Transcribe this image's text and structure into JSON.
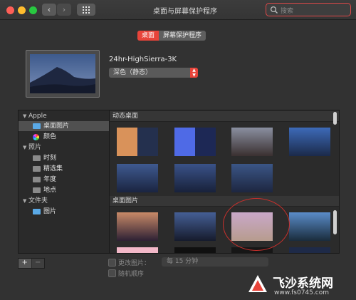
{
  "window": {
    "title": "桌面与屏幕保护程序"
  },
  "search": {
    "placeholder": "搜索"
  },
  "tabs": [
    {
      "label": "桌面",
      "active": true
    },
    {
      "label": "屏幕保护程序",
      "active": false
    }
  ],
  "current": {
    "name": "24hr-HighSierra-3K",
    "style_value": "深色（静态）"
  },
  "sidebar": {
    "groups": [
      {
        "label": "Apple",
        "items": [
          {
            "label": "桌面图片",
            "icon": "folder-blue-icon",
            "selected": true
          },
          {
            "label": "颜色",
            "icon": "color-wheel-icon"
          }
        ]
      },
      {
        "label": "照片",
        "items": [
          {
            "label": "时刻",
            "icon": "folder-icon"
          },
          {
            "label": "精选集",
            "icon": "folder-icon"
          },
          {
            "label": "年度",
            "icon": "folder-icon"
          },
          {
            "label": "地点",
            "icon": "folder-icon"
          }
        ]
      },
      {
        "label": "文件夹",
        "items": [
          {
            "label": "图片",
            "icon": "folder-blue-icon"
          }
        ]
      }
    ]
  },
  "sections": {
    "dynamic": "动态桌面",
    "pictures": "桌面图片"
  },
  "bottom": {
    "add": "+",
    "remove": "−",
    "change_picture": "更改图片：",
    "interval": "每 15 分钟",
    "random": "随机顺序"
  },
  "watermark": {
    "name": "飞沙系统网",
    "url": "www.fs0745.com"
  },
  "colors": {
    "accent": "#e8443a",
    "folder": "#5aa9e6"
  }
}
